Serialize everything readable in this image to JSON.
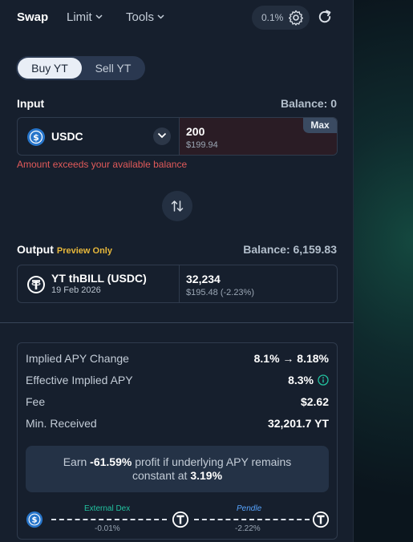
{
  "nav": {
    "swap": "Swap",
    "limit": "Limit",
    "tools": "Tools",
    "slippage": "0.1%"
  },
  "toggle": {
    "buy": "Buy YT",
    "sell": "Sell YT"
  },
  "input": {
    "label": "Input",
    "balance": "Balance: 0",
    "token": "USDC",
    "amount": "200",
    "amount_usd": "$199.94",
    "max_label": "Max",
    "error": "Amount exceeds your available balance"
  },
  "output": {
    "label": "Output",
    "preview": "Preview Only",
    "balance": "Balance: 6,159.83",
    "token": "YT thBILL (USDC)",
    "maturity": "19 Feb 2026",
    "amount": "32,234",
    "amount_usd": "$195.48 (-2.23%)"
  },
  "details": {
    "rows": [
      {
        "label": "Implied APY Change",
        "value": "8.1% → 8.18%"
      },
      {
        "label": "Effective Implied APY",
        "value": "8.3%"
      },
      {
        "label": "Fee",
        "value": "$2.62"
      },
      {
        "label": "Min. Received",
        "value": "32,201.7 YT"
      }
    ],
    "earn": {
      "prefix": "Earn",
      "profit": "-61.59%",
      "middle": "profit if underlying APY remains",
      "line2": "constant at",
      "apy": "3.19%"
    }
  },
  "route": {
    "step1_name": "External Dex",
    "step1_pct": "-0.01%",
    "step2_name": "Pendle",
    "step2_pct": "-2.22%"
  },
  "colors": {
    "accent_teal": "#22c3a0",
    "pendle_blue": "#58a5ff",
    "error_red": "#e15a5a",
    "preview_gold": "#e6b73b",
    "usdc_blue": "#2775ca"
  }
}
